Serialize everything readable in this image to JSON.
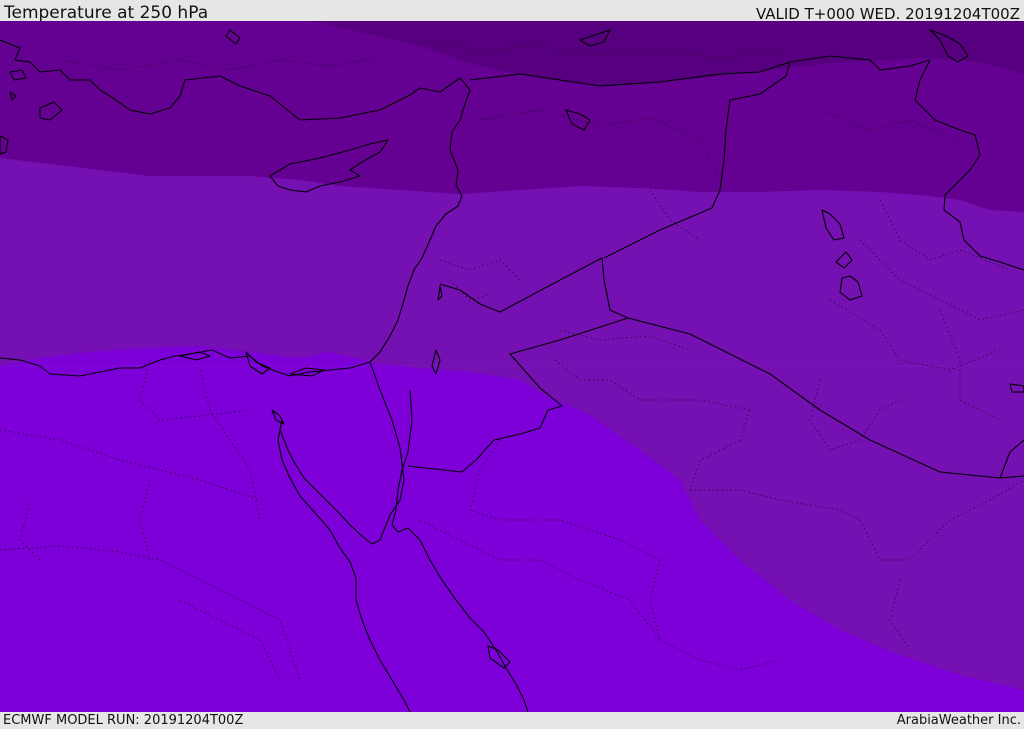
{
  "header": {
    "title": "Temperature at 250 hPa",
    "valid": "VALID T+000 WED. 20191204T00Z"
  },
  "footer": {
    "model_run": "ECMWF MODEL RUN: 20191204T00Z",
    "brand": "ArabiaWeather Inc."
  },
  "map": {
    "parameter": "Temperature",
    "level": "250 hPa",
    "colors": {
      "band_coldest": "#57007f",
      "band_cold": "#640092",
      "band_mid": "#7510b2",
      "band_warm": "#7e00d9",
      "boundary_line": "#000000"
    },
    "features": [
      "coastline",
      "country-border",
      "admin-boundary"
    ]
  }
}
